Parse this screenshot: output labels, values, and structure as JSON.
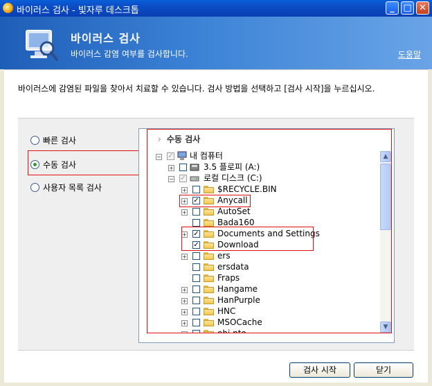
{
  "window": {
    "title": "바이러스 검사 - 빛자루 데스크톱"
  },
  "header": {
    "title": "바이러스 검사",
    "subtitle": "바이러스 감염 여부를 검사합니다.",
    "help": "도움말"
  },
  "description": "바이러스에 감염된 파일을 찾아서 치료할 수 있습니다. 검사 방법을 선택하고 [검사 시작]을 누르십시오.",
  "scan_modes": {
    "quick": "빠른 검사",
    "manual": "수동 검사",
    "custom": "사용자 목록 검사",
    "selected": "수동 검사"
  },
  "tree_panel": {
    "heading": "수동 검사"
  },
  "tree": {
    "root": "내 컴퓨터",
    "floppy": "3.5 플로피 (A:)",
    "local_disk": "로컬 디스크 (C:)",
    "folders": [
      "$RECYCLE.BIN",
      "Anycall",
      "AutoSet",
      "Bada160",
      "Documents and Settings",
      "Download",
      "ers",
      "ersdata",
      "Fraps",
      "Hangame",
      "HanPurple",
      "HNC",
      "MSOCache",
      "ohi nto"
    ],
    "checked": [
      "Anycall",
      "Documents and Settings",
      "Download"
    ]
  },
  "buttons": {
    "start": "검사 시작",
    "close": "닫기"
  },
  "colors": {
    "titlebar": "#0a4fc8",
    "header": "#2f72cc",
    "highlight_box": "#e01010"
  }
}
